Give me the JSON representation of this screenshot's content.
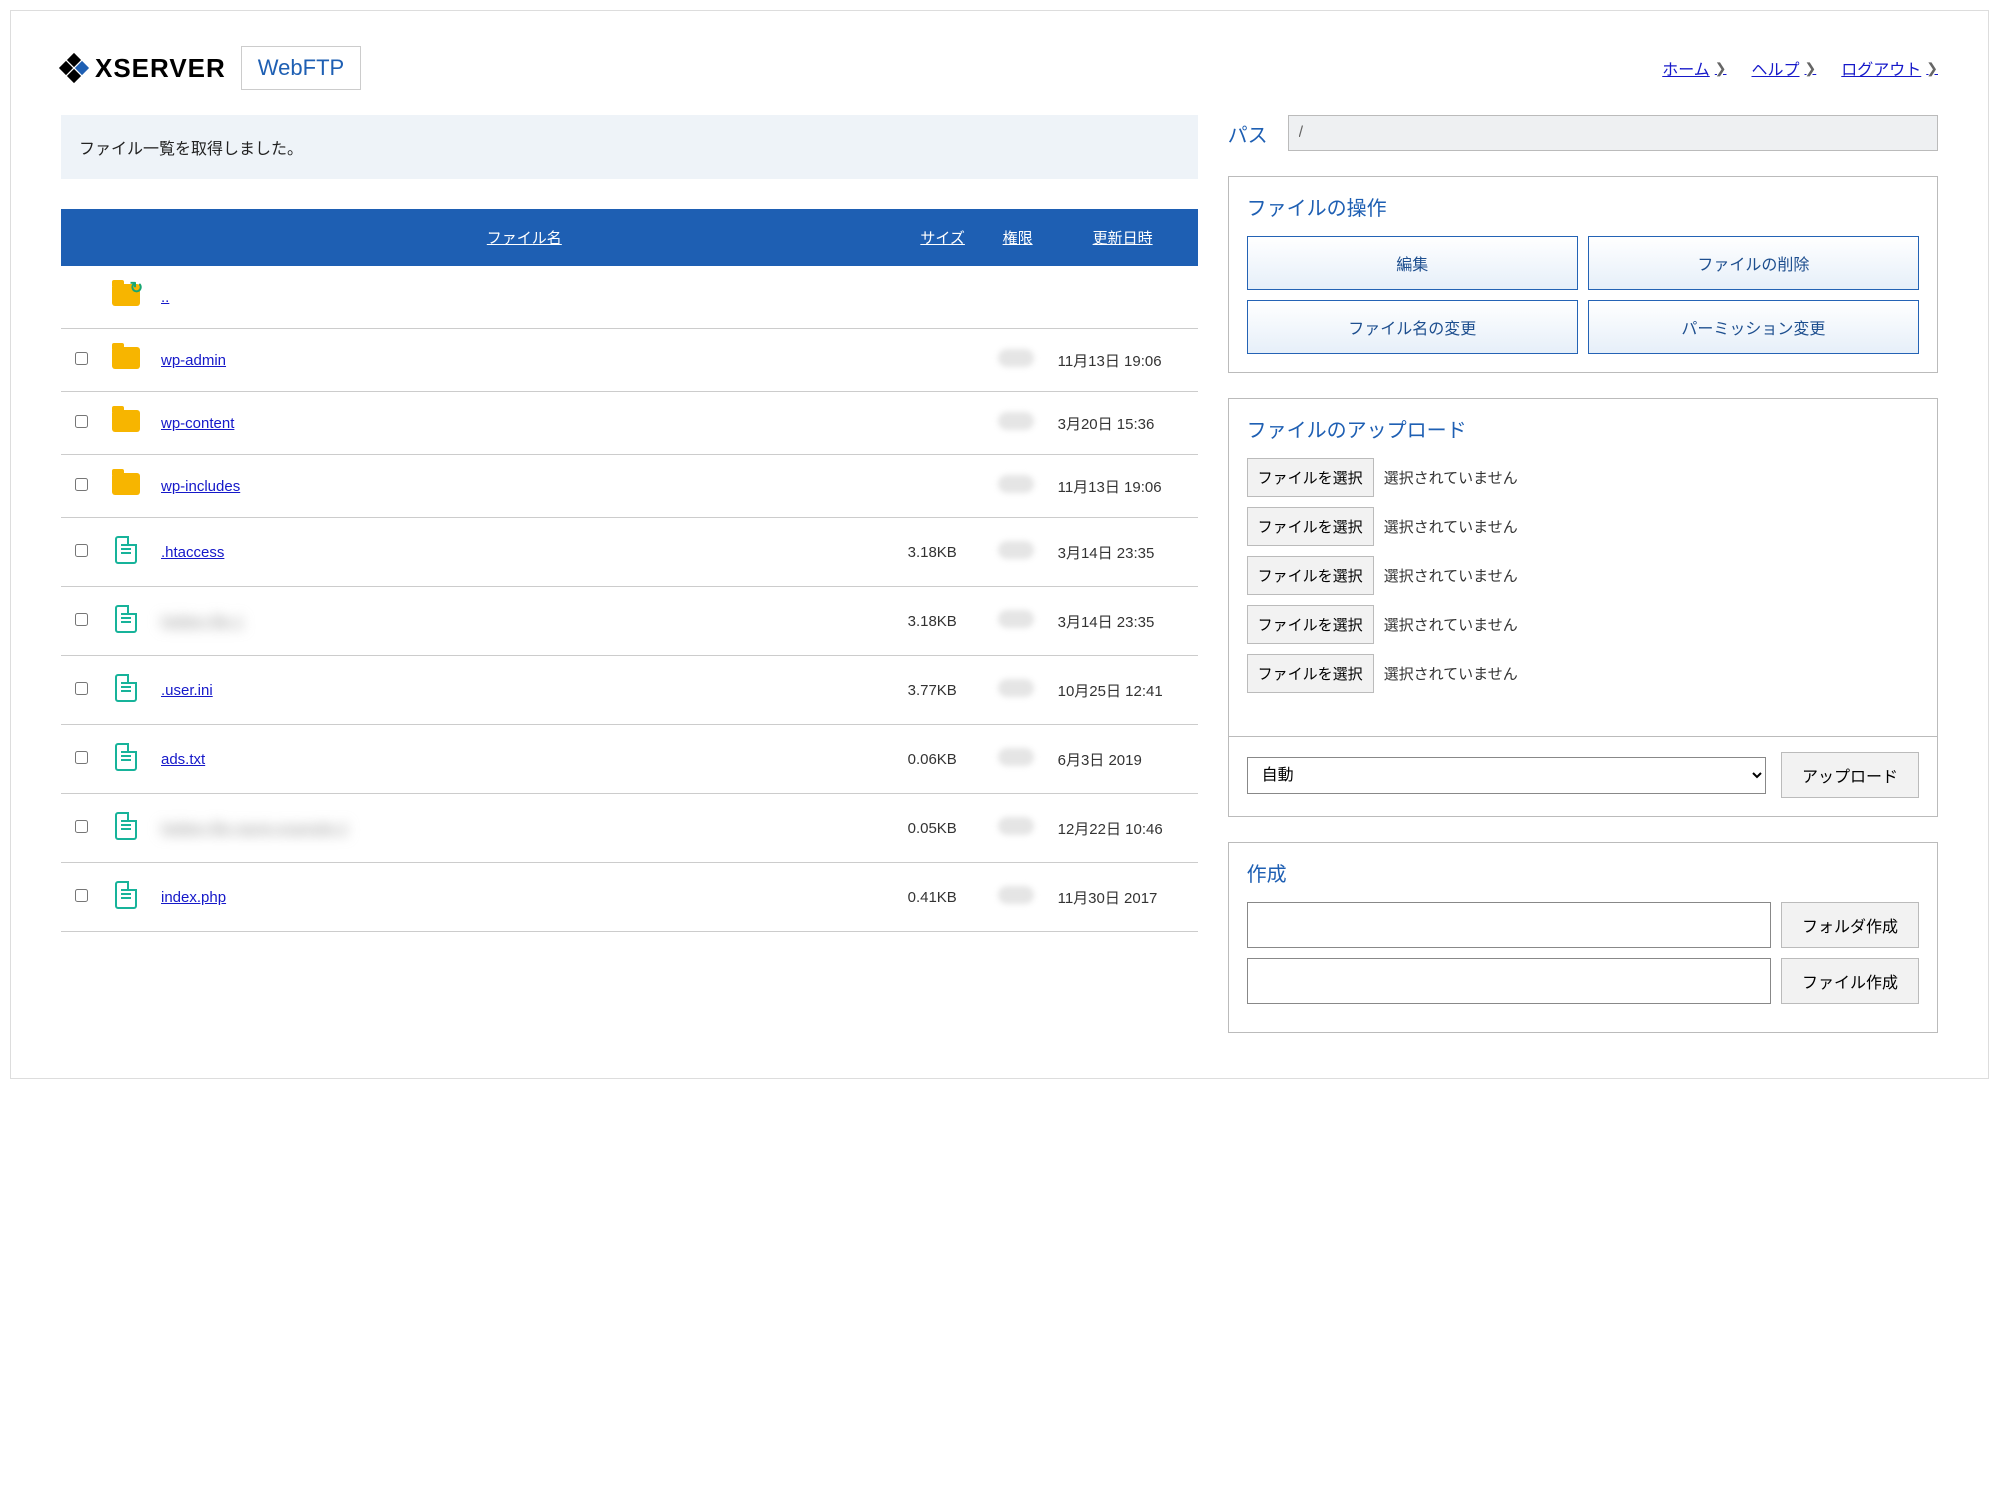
{
  "header": {
    "brand": "XSERVER",
    "product": "WebFTP",
    "nav": {
      "home": "ホーム",
      "help": "ヘルプ",
      "logout": "ログアウト"
    }
  },
  "notice": "ファイル一覧を取得しました。",
  "path": {
    "label": "パス",
    "value": "/"
  },
  "table": {
    "headers": {
      "name": "ファイル名",
      "size": "サイズ",
      "perm": "権限",
      "updated": "更新日時"
    },
    "parent": "..",
    "rows": [
      {
        "type": "folder",
        "name": "wp-admin",
        "size": "",
        "updated": "11月13日 19:06",
        "blurred": false
      },
      {
        "type": "folder",
        "name": "wp-content",
        "size": "",
        "updated": "3月20日 15:36",
        "blurred": false
      },
      {
        "type": "folder",
        "name": "wp-includes",
        "size": "",
        "updated": "11月13日 19:06",
        "blurred": false
      },
      {
        "type": "file",
        "name": ".htaccess",
        "size": "3.18KB",
        "updated": "3月14日 23:35",
        "blurred": false
      },
      {
        "type": "file",
        "name": "hidden-file-1",
        "size": "3.18KB",
        "updated": "3月14日 23:35",
        "blurred": true
      },
      {
        "type": "file",
        "name": ".user.ini",
        "size": "3.77KB",
        "updated": "10月25日 12:41",
        "blurred": false
      },
      {
        "type": "file",
        "name": "ads.txt",
        "size": "0.06KB",
        "updated": "6月3日 2019",
        "blurred": false
      },
      {
        "type": "file",
        "name": "hidden-file-name-example-2",
        "size": "0.05KB",
        "updated": "12月22日 10:46",
        "blurred": true
      },
      {
        "type": "file",
        "name": "index.php",
        "size": "0.41KB",
        "updated": "11月30日 2017",
        "blurred": false
      }
    ]
  },
  "ops": {
    "title": "ファイルの操作",
    "edit": "編集",
    "delete": "ファイルの削除",
    "rename": "ファイル名の変更",
    "perm": "パーミッション変更"
  },
  "upload": {
    "title": "ファイルのアップロード",
    "choose": "ファイルを選択",
    "nofile": "選択されていません",
    "mode": "自動",
    "submit": "アップロード"
  },
  "create": {
    "title": "作成",
    "folder": "フォルダ作成",
    "file": "ファイル作成"
  }
}
